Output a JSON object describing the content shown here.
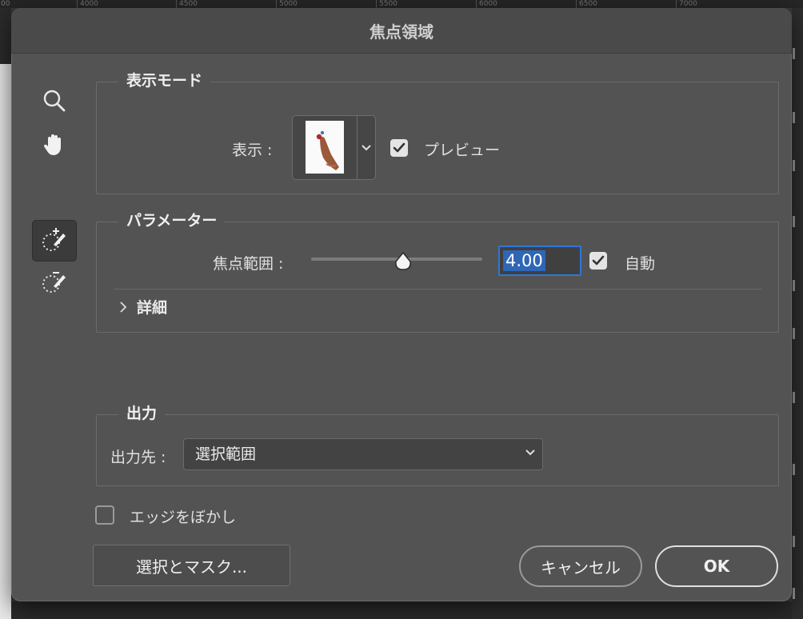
{
  "background": {
    "ruler_ticks": [
      "4000",
      "4500",
      "5000",
      "5500",
      "6000",
      "6500",
      "7000"
    ],
    "ruler_left_fragment": "00"
  },
  "dialog": {
    "title": "焦点領域"
  },
  "tools": [
    {
      "name": "zoom-tool",
      "icon": "magnifier-icon"
    },
    {
      "name": "hand-tool",
      "icon": "hand-icon"
    },
    {
      "name": "focus-area-add-tool",
      "icon": "brush-add-icon",
      "active": true
    },
    {
      "name": "focus-area-subtract-tool",
      "icon": "brush-subtract-icon"
    }
  ],
  "view_mode": {
    "section_title": "表示モード",
    "view_label": "表示 :",
    "preview_label": "プレビュー",
    "preview_checked": true
  },
  "parameters": {
    "section_title": "パラメーター",
    "focus_range_label": "焦点範囲 :",
    "focus_range_value": "4.00",
    "slider_level": 0.49,
    "auto_label": "自動",
    "auto_checked": true,
    "details_label": "詳細"
  },
  "output": {
    "section_title": "出力",
    "output_to_label": "出力先 :",
    "output_to_value": "選択範囲"
  },
  "soften_edge": {
    "label": "エッジをぼかし",
    "checked": false
  },
  "buttons": {
    "select_and_mask": "選択とマスク...",
    "cancel": "キャンセル",
    "ok": "OK"
  },
  "colors": {
    "dialog_bg": "#535353",
    "focus_ring": "#2f76d8",
    "selection": "#2f66b6"
  }
}
